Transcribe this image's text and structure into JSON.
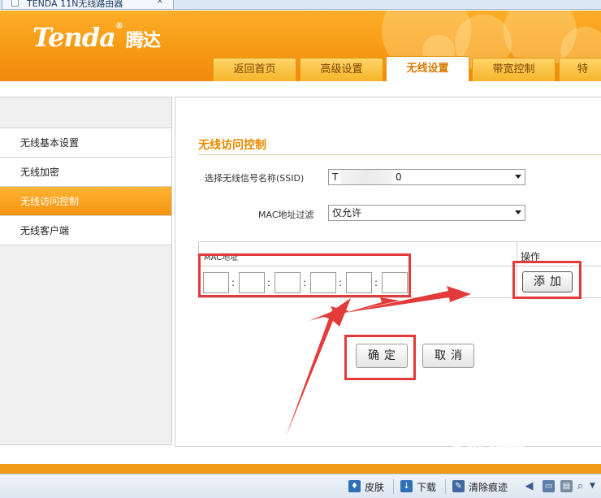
{
  "browser": {
    "tab_title": "TENDA 11N无线路由器",
    "tab_close": "×"
  },
  "logo": {
    "brand": "Tenda",
    "registered": "®",
    "brand_cn": "腾达"
  },
  "nav": {
    "tabs": [
      {
        "label": "返回首页"
      },
      {
        "label": "高级设置"
      },
      {
        "label": "无线设置",
        "active": true
      },
      {
        "label": "带宽控制"
      },
      {
        "label": "特"
      }
    ]
  },
  "sidebar": {
    "items": [
      {
        "label": "无线基本设置"
      },
      {
        "label": "无线加密"
      },
      {
        "label": "无线访问控制",
        "active": true
      },
      {
        "label": "无线客户端"
      }
    ]
  },
  "content": {
    "title": "无线访问控制",
    "ssid_label": "选择无线信号名称(SSID)",
    "ssid_value_prefix": "T",
    "ssid_value_suffix": "0",
    "mac_filter_label": "MAC地址过滤",
    "mac_filter_value": "仅允许",
    "table": {
      "col_mac": "MAC地址",
      "col_op": "操作",
      "mac_fields": [
        "",
        "",
        "",
        "",
        "",
        ""
      ],
      "separator": ":"
    },
    "add_button": "添加",
    "ok_button": "确定",
    "cancel_button": "取消"
  },
  "statusbar": {
    "skin": "皮肤",
    "download": "下载",
    "clear_traces": "清除痕迹"
  },
  "watermark": {
    "text": "Bai 经验",
    "sub": "jingyan.baidu.com"
  },
  "colors": {
    "accent": "#f79a14",
    "annotation": "#e33b3b",
    "title": "#e68b00"
  }
}
